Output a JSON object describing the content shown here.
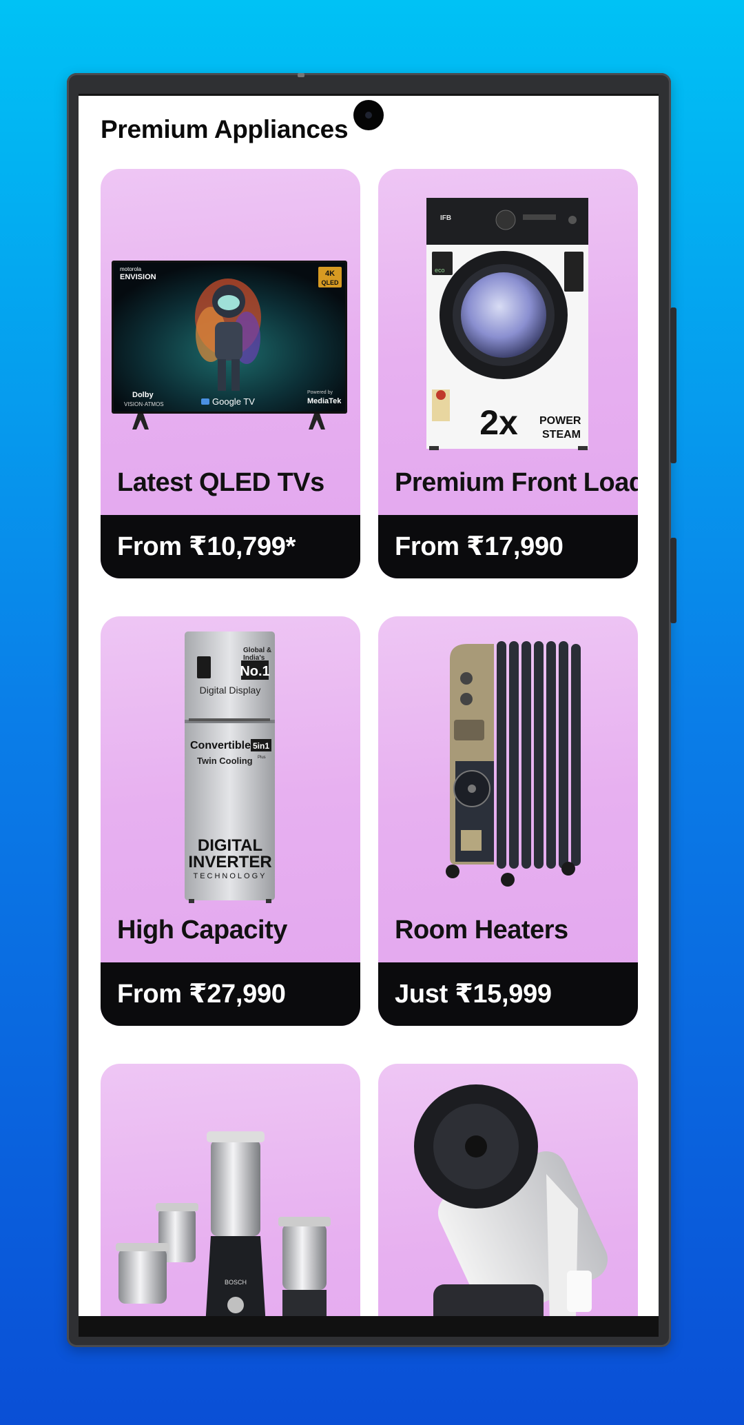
{
  "section_title": "Premium Appliances",
  "cards": [
    {
      "name": "Latest QLED TVs",
      "price": "From ₹10,799*",
      "image_icon": "qled-tv-image",
      "tv_labels": {
        "brand_top": "motorola",
        "brand": "ENVISION",
        "badge_top": "4K",
        "badge_bottom": "QLED",
        "dolby": "Dolby",
        "dolby_sub": "VISION·ATMOS",
        "google": "Google TV",
        "mediatek_top": "Powered by",
        "mediatek": "MediaTek"
      }
    },
    {
      "name": "Premium Front Loads",
      "price": "From ₹17,990",
      "image_icon": "front-load-washer-image",
      "washer_labels": {
        "brand": "IFB",
        "eco": "eco",
        "power": "POWER",
        "steam": "STEAM",
        "multiplier": "2x"
      }
    },
    {
      "name": "High Capacity",
      "price": "From ₹27,990",
      "image_icon": "refrigerator-image",
      "fridge_labels": {
        "badge_top": "Global &",
        "badge_mid": "India's",
        "badge_no1": "No.1",
        "display": "Digital Display",
        "convertible": "Convertible",
        "five_in_one": "5in1",
        "twin": "Twin Cooling",
        "twin_sup": "Plus",
        "digital": "DIGITAL",
        "inverter": "INVERTER",
        "technology": "TECHNOLOGY"
      }
    },
    {
      "name": "Room Heaters",
      "price": "Just ₹15,999",
      "image_icon": "oil-heater-image"
    },
    {
      "name": "",
      "price": "",
      "image_icon": "mixer-grinder-image",
      "mixer_label": "BOSCH"
    },
    {
      "name": "",
      "price": "",
      "image_icon": "air-purifier-fan-image"
    }
  ],
  "colors": {
    "background_top": "#00c2f5",
    "background_bottom": "#0a4fd6",
    "card": "#e7b0f0",
    "price_bar": "#0b0b0d"
  }
}
